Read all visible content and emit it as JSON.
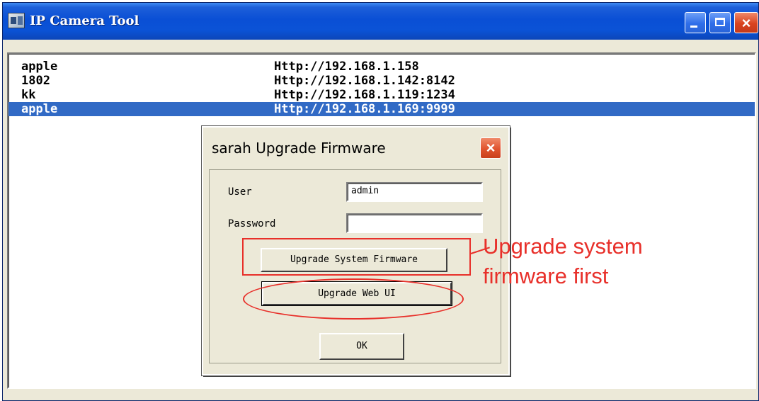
{
  "window": {
    "title": "IP Camera Tool",
    "controls": {
      "minimize": "minimize",
      "maximize": "maximize",
      "close": "×"
    }
  },
  "device_list": {
    "rows": [
      {
        "name": "apple",
        "url": "Http://192.168.1.158",
        "selected": false
      },
      {
        "name": "1802",
        "url": "Http://192.168.1.142:8142",
        "selected": false
      },
      {
        "name": "kk",
        "url": "Http://192.168.1.119:1234",
        "selected": false
      },
      {
        "name": "apple",
        "url": "Http://192.168.1.169:9999",
        "selected": true
      }
    ]
  },
  "dialog": {
    "title": "sarah Upgrade Firmware",
    "close_glyph": "×",
    "user_label": "User",
    "user_value": "admin",
    "password_label": "Password",
    "password_value": "",
    "upgrade_system_label": "Upgrade System Firmware",
    "upgrade_web_label": "Upgrade Web UI",
    "ok_label": "OK"
  },
  "annotation": {
    "text": "Upgrade system\nfirmware first",
    "color": "#e8302a"
  },
  "colors": {
    "titlebar": "#0a4fd5",
    "selection": "#316ac5",
    "dialog_bg": "#ece9d8"
  }
}
